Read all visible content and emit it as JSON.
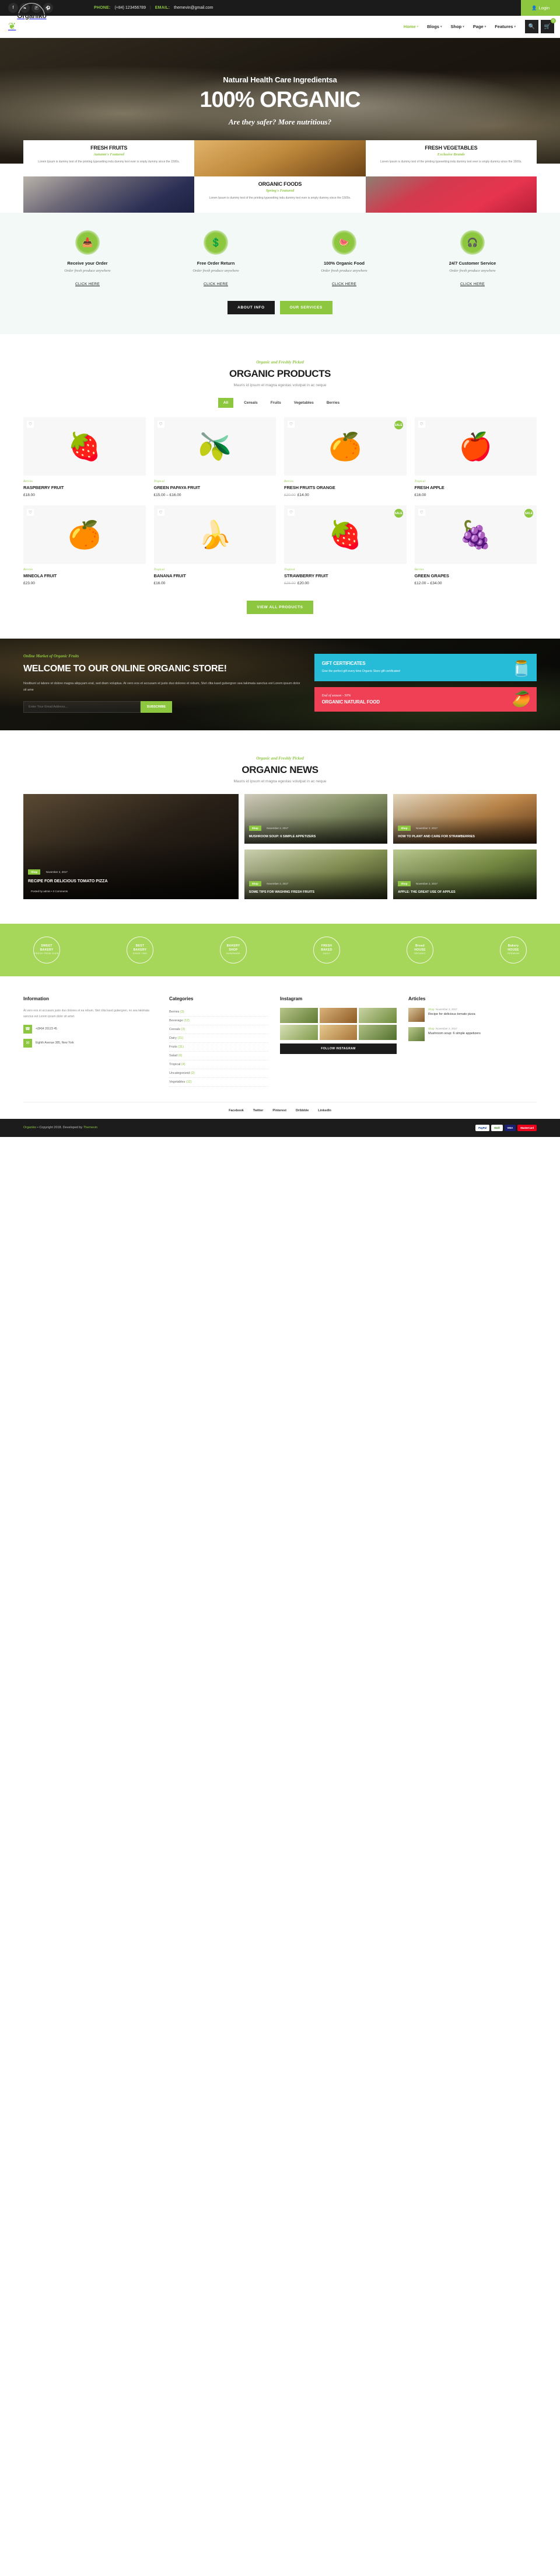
{
  "topbar": {
    "social": [
      {
        "name": "facebook-icon",
        "glyph": "f"
      },
      {
        "name": "twitter-icon",
        "glyph": "❧"
      },
      {
        "name": "pinterest-icon",
        "glyph": "Ⓟ"
      },
      {
        "name": "dribbble-icon",
        "glyph": "⚽"
      }
    ],
    "phone_label": "PHONE:",
    "phone_value": "(+84) 123456789",
    "separator": "|",
    "email_label": "EMAIL:",
    "email_value": "themevin@gmail.com",
    "login_label": "Login",
    "login_icon": "👤"
  },
  "header": {
    "brand": "Organiko",
    "tagline": "PRODUCTS AND SUPPLY",
    "leaf_icon": "❦",
    "nav": [
      {
        "label": "Home",
        "caret": "▾",
        "active": true
      },
      {
        "label": "Blogs",
        "caret": "▾",
        "active": false
      },
      {
        "label": "Shop",
        "caret": "▾",
        "active": false
      },
      {
        "label": "Page",
        "caret": "▾",
        "active": false
      },
      {
        "label": "Features",
        "caret": "▾",
        "active": false
      }
    ],
    "search_icon": "🔍",
    "cart_icon": "🛒",
    "cart_count": "0"
  },
  "hero": {
    "subtitle": "Natural Health Care Ingredientsa",
    "title": "100% ORGANIC",
    "note": "Are they safer? More nutritious?"
  },
  "features": [
    {
      "kind": "text",
      "title": "FRESH FRUITS",
      "subtitle": "Autumn's Featured",
      "text": "Lorem Ipsum is dummy text of the printing typesetting indu dummy text ever is smply dummy since the 1500s."
    },
    {
      "kind": "image",
      "name": "bread-photo"
    },
    {
      "kind": "text",
      "title": "FRESH VEGETABLES",
      "subtitle": "Exclusive Brands",
      "text": "Lorem Ipsum is dummy text of the printing typesetting indu dummy text ever is smply dummy since the 1500s."
    },
    {
      "kind": "image",
      "name": "blueberries-photo"
    },
    {
      "kind": "text",
      "title": "ORGANIC FOODS",
      "subtitle": "Spring's Featured",
      "text": "Lorem Ipsum is dummy text of the printing typesetting indu dummy text ever is smply dummy since the 1500s."
    },
    {
      "kind": "image",
      "name": "raspberries-photo"
    }
  ],
  "services": {
    "items": [
      {
        "icon": "📥",
        "icon_name": "receive-order-icon",
        "title": "Receive your Order",
        "desc": "Order fresh produce anywhere",
        "link": "CLICK HERE"
      },
      {
        "icon": "💲",
        "icon_name": "free-return-icon",
        "title": "Free Order Return",
        "desc": "Order fresh produce anywhere",
        "link": "CLICK HERE"
      },
      {
        "icon": "🍉",
        "icon_name": "organic-food-icon",
        "title": "100% Organic Food",
        "desc": "Order fresh produce anywhere",
        "link": "CLICK HERE"
      },
      {
        "icon": "🎧",
        "icon_name": "customer-service-icon",
        "title": "24/7 Customer Service",
        "desc": "Order fresh produce anywhere",
        "link": "CLICK HERE"
      }
    ],
    "btn_about": "ABOUT INFO",
    "btn_services": "OUR SERVICES"
  },
  "products_section": {
    "eyebrow": "Organic and Freshly Picked",
    "title": "ORGANIC PRODUCTS",
    "lead": "Mauris id ipsum et magna egestas volutpat in ac neque",
    "filters": [
      "All",
      "Cereals",
      "Fruits",
      "Vegetables",
      "Berries"
    ],
    "active_filter": "All",
    "view_all": "VIEW ALL PRODUCTS",
    "wish_icon": "♡",
    "items": [
      {
        "fruit": "🍓",
        "category": "Berries",
        "name": "RASPBERRY FRUIT",
        "price": "£18.00",
        "old_price": "",
        "sale": ""
      },
      {
        "fruit": "🫒",
        "category": "Tropical",
        "name": "GREEN PAPAYA FRUIT",
        "price": "£15.00  –  £16.00",
        "old_price": "",
        "sale": ""
      },
      {
        "fruit": "🍊",
        "category": "Berries",
        "name": "FRESH FRUITS ORANGE",
        "price": "£14.00",
        "old_price": "£20.00",
        "sale": "SALE"
      },
      {
        "fruit": "🍎",
        "category": "Tropical",
        "name": "FRESH APPLE",
        "price": "£16.00",
        "old_price": "",
        "sale": ""
      },
      {
        "fruit": "🍊",
        "category": "Berries",
        "name": "MINEOLA FRUIT",
        "price": "£23.00",
        "old_price": "",
        "sale": ""
      },
      {
        "fruit": "🍌",
        "category": "Tropical",
        "name": "BANANA FRUIT",
        "price": "£16.00",
        "old_price": "",
        "sale": ""
      },
      {
        "fruit": "🍓",
        "category": "Tropical",
        "name": "STRAWBERRY FRUIT",
        "price": "£20.00",
        "old_price": "£28.00",
        "sale": "SALE"
      },
      {
        "fruit": "🍇",
        "category": "Berries",
        "name": "GREEN GRAPES",
        "price": "£12.00  –  £34.00",
        "old_price": "",
        "sale": "SALE"
      }
    ]
  },
  "welcome": {
    "eyebrow": "Online Market of Organic Fruits",
    "title": "WELCOME TO OUR ONLINE ORGANIC STORE!",
    "text": "Nostbunt ut labore et dolore magna aliquyam erat, sed diam voluptua. At vero eos et accusam et justo duo dolores et rebum, Stet clita kasd gubergren sea takimata sanctus est Lorem ipsum dolor sit ame",
    "email_placeholder": "Enter Your Email Address...",
    "subscribe_label": "SUBSCRIBE",
    "promo_blue": {
      "title": "GIFT CERTIFICATES",
      "text": "Give the perfect gift every time Organic Store gift certificates!",
      "object": "🫙"
    },
    "promo_red": {
      "eyebrow": "End of season - 50%",
      "title": "ORGANIC NATURAL FOOD",
      "object": "🥭"
    }
  },
  "news_section": {
    "eyebrow": "Organic and Freshly Picked",
    "title": "ORGANIC NEWS",
    "lead": "Mauris id ipsum et magna egestas volutpat in ac neque",
    "main": {
      "cat": "Shop",
      "meta": "November 2, 2017",
      "title": "RECIPE FOR DELICIOUS TOMATO PIZZA",
      "footer": "Posted by admin   •   0 Comments"
    },
    "items": [
      {
        "cat": "Shop",
        "meta": "November 2, 2017",
        "title": "MUSHROOM SOUP: 6 SIMPLE APPETIZERS"
      },
      {
        "cat": "Shop",
        "meta": "November 2, 2017",
        "title": "HOW TO PLANT AND CARE FOR STRAWBERRIES"
      },
      {
        "cat": "Shop",
        "meta": "November 2, 2017",
        "title": "SOME TIPS FOR WASHING FRESH FRUITS"
      },
      {
        "cat": "Shop",
        "meta": "November 2, 2017",
        "title": "APPLE: THE GREAT USE OF APPLES"
      }
    ]
  },
  "brands": [
    {
      "line1": "SWEET",
      "line2": "BAKERY",
      "tiny": "FRESH FROM OVEN"
    },
    {
      "line1": "BEST",
      "line2": "BAKERY",
      "tiny": "SINCE 1980"
    },
    {
      "line1": "BAKERY",
      "line2": "SHOP",
      "tiny": "HANDMADE"
    },
    {
      "line1": "FRESH",
      "line2": "BAKED",
      "tiny": "DAILY"
    },
    {
      "line1": "Bread",
      "line2": "HOUSE",
      "tiny": "ORGANIC"
    },
    {
      "line1": "Bakery",
      "line2": "HOUSE",
      "tiny": "PREMIUM"
    }
  ],
  "footer": {
    "information": {
      "title": "Information",
      "text": "At vero eos et accusam justo duo dolores et ea rebum. Stet clita kasd gubergren, no sea takimata sanctus est Lorem ipsum dolor sit amet.",
      "phone_icon": "☎",
      "phone": "+(84)4 20123 45",
      "address_icon": "✉",
      "address": "Eighth Avenue 385, New York"
    },
    "categories": {
      "title": "Categories",
      "items": [
        {
          "label": "Berries",
          "count": "(3)"
        },
        {
          "label": "Beverage",
          "count": "(12)"
        },
        {
          "label": "Cereals",
          "count": "(3)"
        },
        {
          "label": "Dairy",
          "count": "(21)"
        },
        {
          "label": "Fruits",
          "count": "(31)"
        },
        {
          "label": "Salad",
          "count": "(6)"
        },
        {
          "label": "Tropical",
          "count": "(4)"
        },
        {
          "label": "Uncategorized",
          "count": "(2)"
        },
        {
          "label": "Vegetables",
          "count": "(12)"
        }
      ]
    },
    "instagram": {
      "title": "Instagram",
      "button": "FOLLOW INSTAGRAM"
    },
    "articles": {
      "title": "Articles",
      "items": [
        {
          "cat": "Shop",
          "meta": "November 2, 2017",
          "title": "Recipe for delicious tomato pizza"
        },
        {
          "cat": "Shop",
          "meta": "November 2, 2017",
          "title": "Mushroom soup: 6 simple appetizers"
        }
      ]
    },
    "nav": [
      "Facebook",
      "Twitter",
      "Pinterest",
      "Dribbble",
      "LinkedIn"
    ],
    "copyright_brand": "Organiko",
    "copyright_text": "• Copyright 2018. Developed by",
    "copyright_author": "Themevin",
    "payments": [
      {
        "label": "PayPal",
        "cls": "pp"
      },
      {
        "label": "Skrill",
        "cls": "sk"
      },
      {
        "label": "VISA",
        "cls": "visa"
      },
      {
        "label": "MasterCard",
        "cls": "mc"
      }
    ]
  }
}
